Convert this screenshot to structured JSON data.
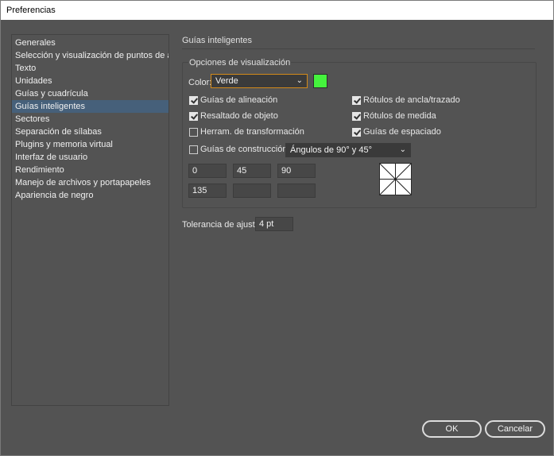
{
  "window": {
    "title": "Preferencias"
  },
  "sidebar": {
    "items": [
      {
        "label": "Generales"
      },
      {
        "label": "Selección y visualización de puntos de ancla"
      },
      {
        "label": "Texto"
      },
      {
        "label": "Unidades"
      },
      {
        "label": "Guías y cuadrícula"
      },
      {
        "label": "Guías inteligentes",
        "selected": true
      },
      {
        "label": "Sectores"
      },
      {
        "label": "Separación de sílabas"
      },
      {
        "label": "Plugins y memoria virtual"
      },
      {
        "label": "Interfaz de usuario"
      },
      {
        "label": "Rendimiento"
      },
      {
        "label": "Manejo de archivos y portapapeles"
      },
      {
        "label": "Apariencia de negro"
      }
    ]
  },
  "main": {
    "section_title": "Guías inteligentes",
    "display_options": {
      "title": "Opciones de visualización",
      "color_label": "Color:",
      "color_value": "Verde",
      "color_swatch": "#45f33d",
      "checkboxes": {
        "alignment_guides": {
          "label": "Guías de alineación",
          "checked": true
        },
        "anchor_path_labels": {
          "label": "Rótulos de ancla/trazado",
          "checked": true
        },
        "object_highlighting": {
          "label": "Resaltado de objeto",
          "checked": true
        },
        "measurement_labels": {
          "label": "Rótulos de medida",
          "checked": true
        },
        "transform_tools": {
          "label": "Herram. de transformación",
          "checked": false
        },
        "spacing_guides": {
          "label": "Guías de espaciado",
          "checked": true
        },
        "construction_guides": {
          "label": "Guías de construcción:",
          "checked": false
        }
      },
      "construction_angles_value": "Ángulos de 90° y 45°",
      "angle_fields": [
        "0",
        "45",
        "90",
        "135",
        "",
        ""
      ]
    },
    "snapping_tolerance": {
      "label": "Tolerancia de ajuste:",
      "value": "4 pt"
    }
  },
  "buttons": {
    "ok": "OK",
    "cancel": "Cancelar"
  }
}
